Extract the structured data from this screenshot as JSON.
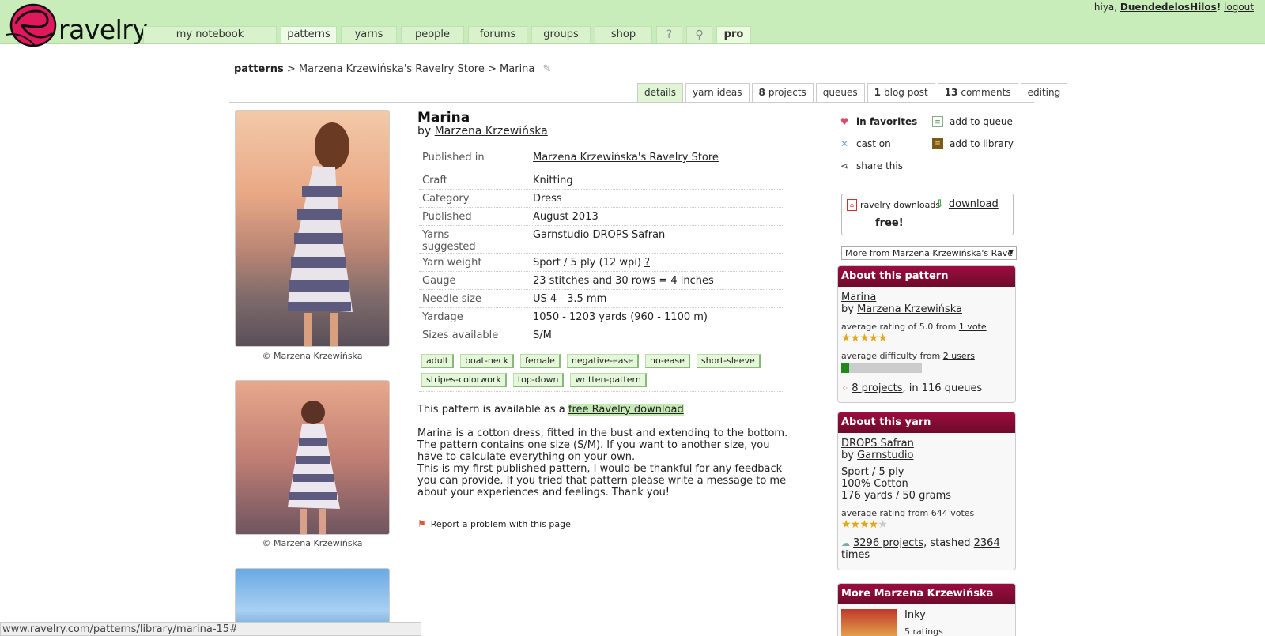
{
  "header": {
    "logo_text": "ravelry",
    "nav": [
      "my notebook",
      "patterns",
      "yarns",
      "people",
      "forums",
      "groups",
      "shop"
    ],
    "nav_pro": "pro",
    "user_greeting": "hiya,",
    "username": "DuendedelosHilos",
    "user_suffix": "!",
    "logout": "logout"
  },
  "breadcrumb": {
    "root": "patterns",
    "sep": ">",
    "store": "Marzena Krzewińska's Ravelry Store",
    "current": "Marina"
  },
  "tabs": [
    {
      "label": "details",
      "count": ""
    },
    {
      "label": "yarn ideas",
      "count": ""
    },
    {
      "label": "projects",
      "count": "8"
    },
    {
      "label": "queues",
      "count": ""
    },
    {
      "label": "blog post",
      "count": "1"
    },
    {
      "label": "comments",
      "count": "13"
    },
    {
      "label": "editing",
      "count": ""
    }
  ],
  "photos": {
    "caption": "© Marzena Krzewińska"
  },
  "pattern": {
    "title": "Marina",
    "by": "by",
    "author": "Marzena Krzewińska",
    "details": [
      {
        "key": "Published in",
        "value": "Marzena Krzewińska's Ravelry Store"
      },
      {
        "key": "Craft",
        "value": "Knitting"
      },
      {
        "key": "Category",
        "value": "Dress"
      },
      {
        "key": "Published",
        "value": "August 2013"
      },
      {
        "key": "Yarns suggested",
        "value": "Garnstudio DROPS Safran"
      },
      {
        "key": "Yarn weight",
        "value": "Sport / 5 ply (12 wpi)",
        "extra": "?"
      },
      {
        "key": "Gauge",
        "value": "23 stitches and 30 rows = 4 inches"
      },
      {
        "key": "Needle size",
        "value": "US 4 - 3.5 mm"
      },
      {
        "key": "Yardage",
        "value": "1050 - 1203 yards (960 - 1100 m)"
      },
      {
        "key": "Sizes available",
        "value": "S/M"
      }
    ],
    "tags": [
      "adult",
      "boat-neck",
      "female",
      "negative-ease",
      "no-ease",
      "short-sleeve",
      "stripes-colorwork",
      "top-down",
      "written-pattern"
    ],
    "availability_prefix": "This pattern is available as a",
    "availability_link": "free Ravelry download",
    "description": [
      "Marina is a cotton dress, fitted in the bust and extending to the bottom.",
      "The pattern contains one size (S/M). If you want to another size, you",
      "have to calculate everything on your own.",
      "This is my first published pattern, I would be thankful for any feedback",
      "you can provide. If you tried that pattern please write a message to me",
      "about your experiences and feelings. Thank you!"
    ],
    "report": "Report a problem with this page"
  },
  "actions": {
    "favorites": "in favorites",
    "queue": "add to queue",
    "cast_on": "cast on",
    "library": "add to library",
    "share": "share this"
  },
  "download": {
    "label": "ravelry downloads",
    "link": "download",
    "price": "free!"
  },
  "more_select": "More from Marzena Krzewińska's Ravelry Store",
  "about_pattern": {
    "heading": "About this pattern",
    "name": "Marina",
    "by": "by",
    "author": "Marzena Krzewińska",
    "rating_text": "average rating of 5.0 from",
    "rating_votes": "1 vote",
    "rating": 5,
    "difficulty_text": "average difficulty from",
    "difficulty_users": "2 users",
    "difficulty_fraction": 0.1,
    "projects_link": "8 projects",
    "projects_suffix": ", in 116 queues"
  },
  "about_yarn": {
    "heading": "About this yarn",
    "name": "DROPS Safran",
    "by": "by",
    "brand": "Garnstudio",
    "weight": "Sport / 5 ply",
    "fiber": "100% Cotton",
    "yardage": "176 yards / 50 grams",
    "rating_text": "average rating from 644 votes",
    "rating": 4,
    "projects_link": "3296 projects",
    "stashed_text": ", stashed",
    "stashed_link_1": "2364",
    "stashed_link_2": "times"
  },
  "more_from": {
    "heading": "More Marzena Krzewińska",
    "item": "Inky",
    "ratings": "5 ratings"
  },
  "status_bar": "www.ravelry.com/patterns/library/marina-15#"
}
